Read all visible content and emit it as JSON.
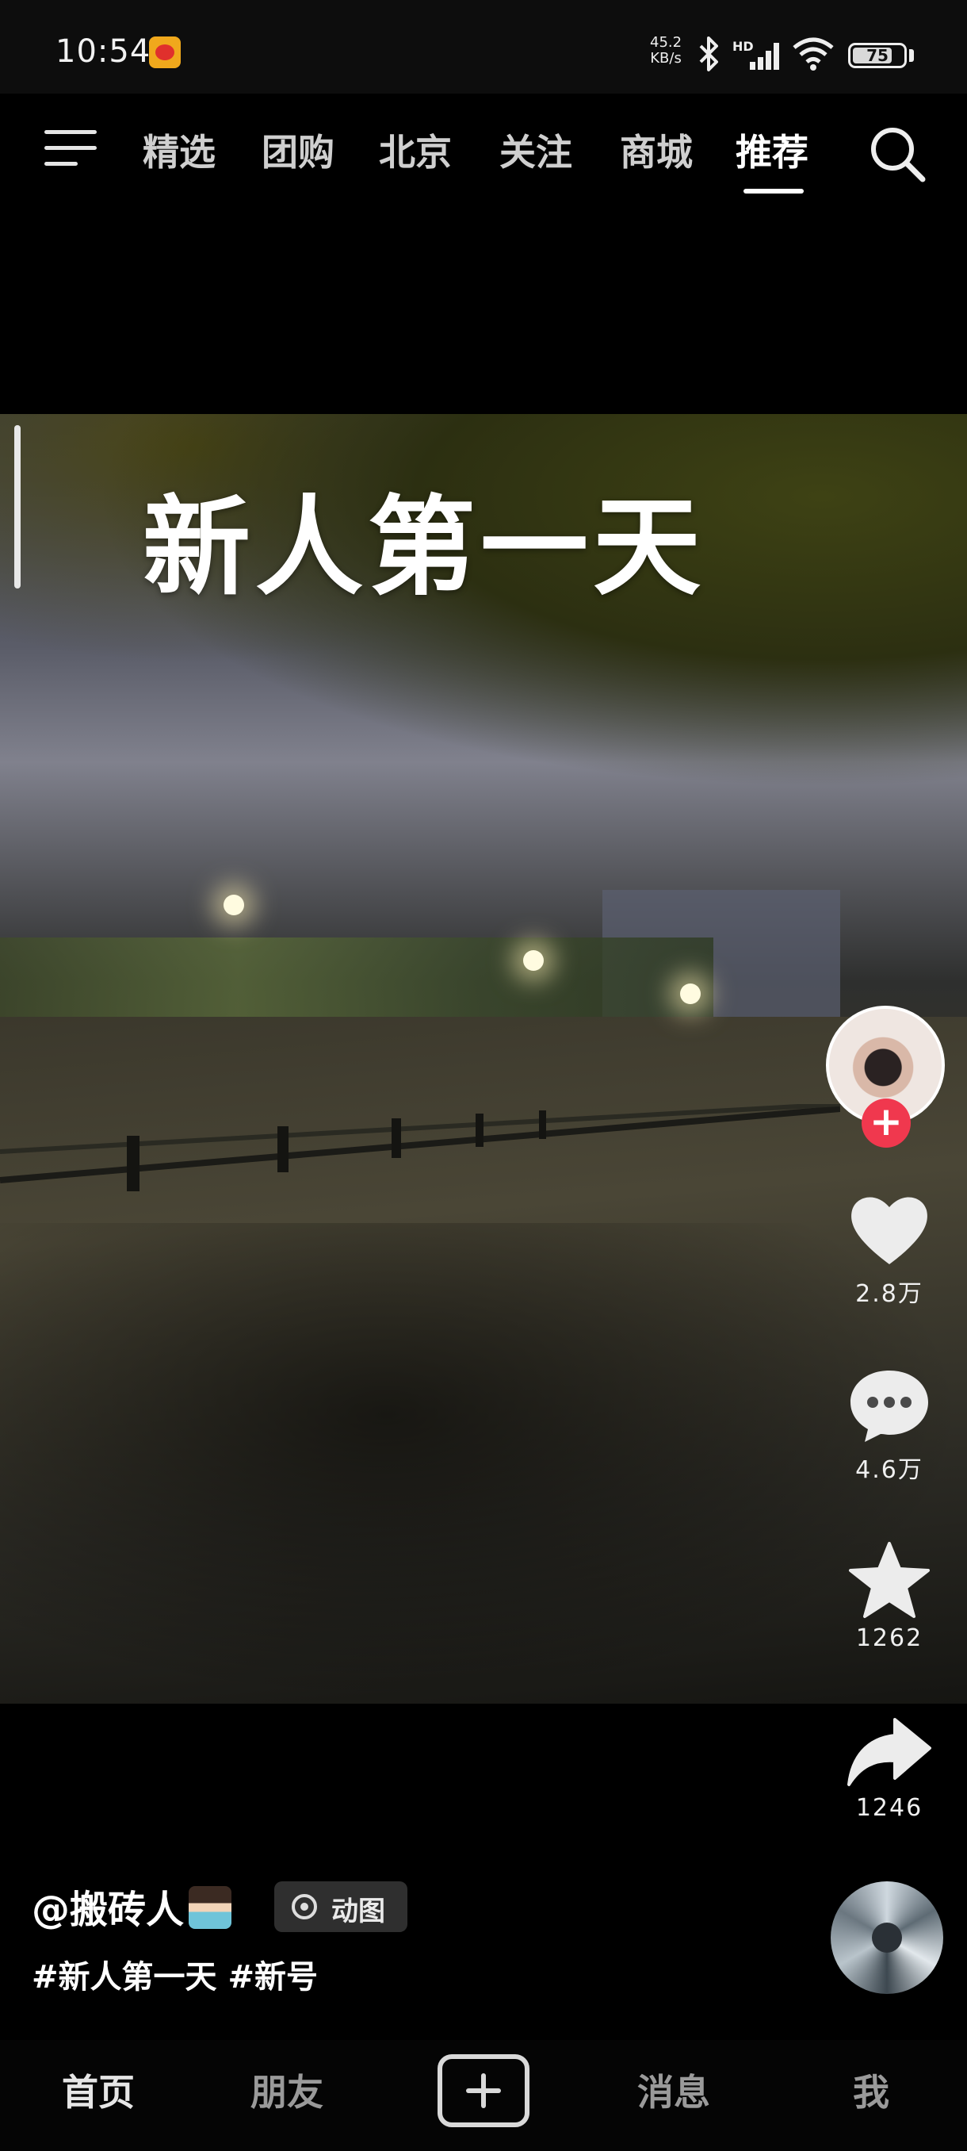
{
  "status_bar": {
    "time": "10:54",
    "network_speed_value": "45.2",
    "network_speed_unit": "KB/s",
    "signal_label": "HD",
    "battery": "75",
    "icons": [
      "weibo-notification-icon",
      "bluetooth-icon",
      "signal-icon",
      "wifi-icon",
      "battery-icon"
    ]
  },
  "top_nav": {
    "tabs": [
      {
        "label": "精选"
      },
      {
        "label": "团购"
      },
      {
        "label": "北京"
      },
      {
        "label": "关注"
      },
      {
        "label": "商城"
      },
      {
        "label": "推荐",
        "active": true
      }
    ],
    "icons": [
      "menu-icon",
      "search-icon"
    ]
  },
  "video": {
    "overlay_text": "新人第一天"
  },
  "actions": {
    "likes": "2.8万",
    "comments": "4.6万",
    "favorites": "1262",
    "shares": "1246",
    "follow_symbol": "+"
  },
  "caption": {
    "author": "@搬砖人",
    "badge": "动图",
    "hashtags": "#新人第一天 #新号"
  },
  "bottom_nav": {
    "items": [
      {
        "label": "首页",
        "active": true
      },
      {
        "label": "朋友"
      },
      {
        "label": "消息"
      },
      {
        "label": "我"
      }
    ]
  },
  "colors": {
    "accent_follow": "#f0384e",
    "background": "#000000"
  }
}
